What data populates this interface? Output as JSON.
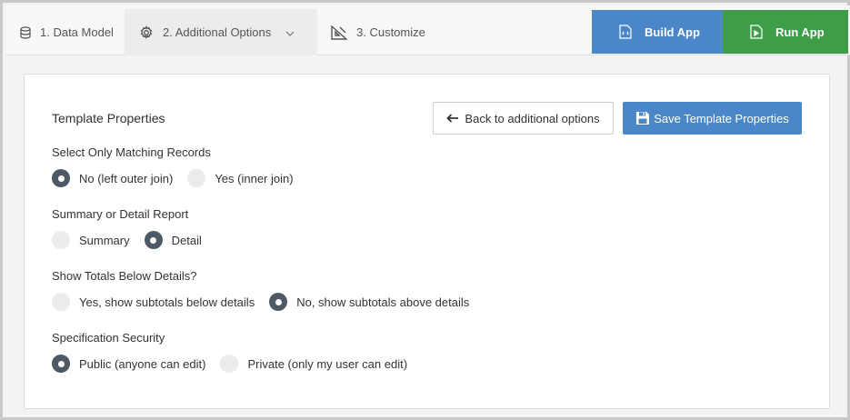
{
  "nav": {
    "steps": [
      {
        "label": "1. Data Model",
        "icon": "database-icon"
      },
      {
        "label": "2. Additional Options",
        "icon": "gear-icon"
      },
      {
        "label": "3. Customize",
        "icon": "design-tools-icon"
      }
    ],
    "build_label": "Build App",
    "run_label": "Run App",
    "colors": {
      "build": "#4a86c8",
      "run": "#3e9d48"
    }
  },
  "card": {
    "title": "Template Properties",
    "back_label": "Back to additional options",
    "save_label": "Save Template Properties"
  },
  "groups": [
    {
      "label": "Select Only Matching Records",
      "options": [
        {
          "label": "No (left outer join)",
          "checked": true
        },
        {
          "label": "Yes (inner join)",
          "checked": false
        }
      ]
    },
    {
      "label": "Summary or Detail Report",
      "options": [
        {
          "label": "Summary",
          "checked": false
        },
        {
          "label": "Detail",
          "checked": true
        }
      ]
    },
    {
      "label": "Show Totals Below Details?",
      "options": [
        {
          "label": "Yes, show subtotals below details",
          "checked": false
        },
        {
          "label": "No, show subtotals above details",
          "checked": true
        }
      ]
    },
    {
      "label": "Specification Security",
      "options": [
        {
          "label": "Public (anyone can edit)",
          "checked": true
        },
        {
          "label": "Private (only my user can edit)",
          "checked": false
        }
      ]
    }
  ]
}
